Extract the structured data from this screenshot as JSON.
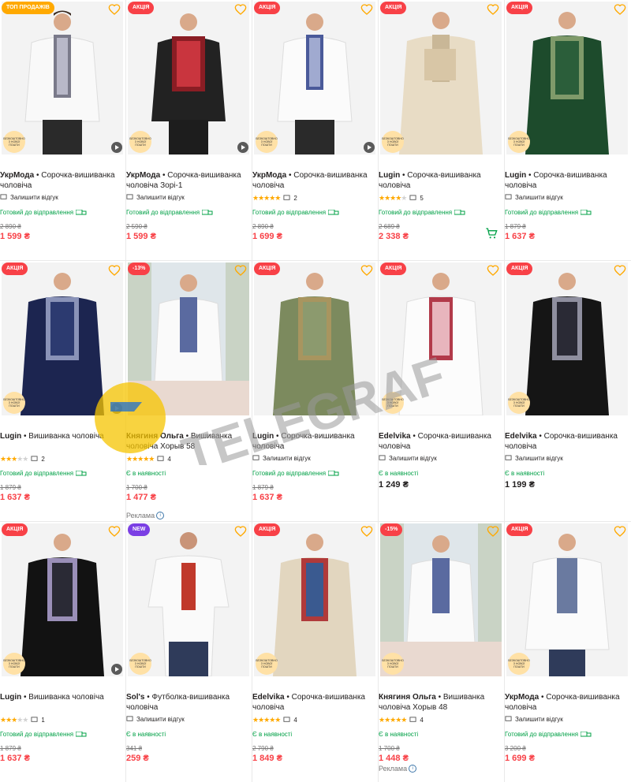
{
  "badges": {
    "top": "ТОП ПРОДАЖІВ",
    "sale": "АКЦІЯ",
    "new": "NEW",
    "m13": "-13%",
    "m15": "-15%"
  },
  "free_text": "БЕЗКОШТОВНО З НОВОЇ ПОШТИ",
  "leave_review": "Залишити відгук",
  "ready": "Готовий до відправлення",
  "in_stock": "Є в наявності",
  "ad": "Реклама",
  "watermark": "TELEGRAF",
  "colors": {
    "accent": "#ffa900",
    "sale": "#f84147",
    "green": "#00a046",
    "new": "#7b3fe4"
  },
  "products": [
    {
      "brand": "УкрМода",
      "name": " • Сорочка-вишиванка чоловіча",
      "reviews": "",
      "rating": 0,
      "old": "2 890 ₴",
      "price": "1 599 ₴"
    },
    {
      "brand": "УкрМода",
      "name": " • Сорочка-вишиванка чоловіча Зорі-1",
      "reviews": "",
      "rating": 0,
      "old": "2 590 ₴",
      "price": "1 599 ₴"
    },
    {
      "brand": "УкрМода",
      "name": " • Сорочка-вишиванка чоловіча",
      "reviews": "2",
      "rating": 5,
      "old": "2 890 ₴",
      "price": "1 699 ₴"
    },
    {
      "brand": "Lugin",
      "name": " • Сорочка-вишиванка чоловіча",
      "reviews": "5",
      "rating": 4,
      "old": "2 689 ₴",
      "price": "2 338 ₴"
    },
    {
      "brand": "Lugin",
      "name": " • Сорочка-вишиванка чоловіча",
      "reviews": "",
      "rating": 0,
      "old": "1 879 ₴",
      "price": "1 637 ₴"
    },
    {
      "brand": "Lugin",
      "name": " • Вишиванка чоловіча",
      "reviews": "2",
      "rating": 3,
      "old": "1 879 ₴",
      "price": "1 637 ₴"
    },
    {
      "brand": "Княгиня Ольга",
      "name": " • Вишиванка чоловіча Хорыв 58",
      "reviews": "4",
      "rating": 5,
      "old": "1 700 ₴",
      "price": "1 477 ₴"
    },
    {
      "brand": "Lugin",
      "name": " • Сорочка-вишиванка чоловіча",
      "reviews": "",
      "rating": 0,
      "old": "1 879 ₴",
      "price": "1 637 ₴"
    },
    {
      "brand": "Edelvika",
      "name": " • Сорочка-вишиванка чоловіча",
      "reviews": "",
      "rating": 0,
      "old": "",
      "price": "1 249 ₴"
    },
    {
      "brand": "Edelvika",
      "name": " • Сорочка-вишиванка чоловіча",
      "reviews": "",
      "rating": 0,
      "old": "",
      "price": "1 199 ₴"
    },
    {
      "brand": "Lugin",
      "name": " • Вишиванка чоловіча",
      "reviews": "1",
      "rating": 3,
      "old": "1 879 ₴",
      "price": "1 637 ₴"
    },
    {
      "brand": "Sol's",
      "name": " • Футболка-вишиванка чоловіча",
      "reviews": "",
      "rating": 0,
      "old": "341 ₴",
      "price": "259 ₴"
    },
    {
      "brand": "Edelvika",
      "name": " • Сорочка-вишиванка чоловіча",
      "reviews": "4",
      "rating": 5,
      "old": "2 790 ₴",
      "price": "1 849 ₴"
    },
    {
      "brand": "Княгиня Ольга",
      "name": " • Вишиванка чоловіча Хорыв 48",
      "reviews": "4",
      "rating": 5,
      "old": "1 700 ₴",
      "price": "1 448 ₴"
    },
    {
      "brand": "УкрМода",
      "name": " • Сорочка-вишиванка чоловіча",
      "reviews": "",
      "rating": 0,
      "old": "3 200 ₴",
      "price": "1 699 ₴"
    }
  ]
}
